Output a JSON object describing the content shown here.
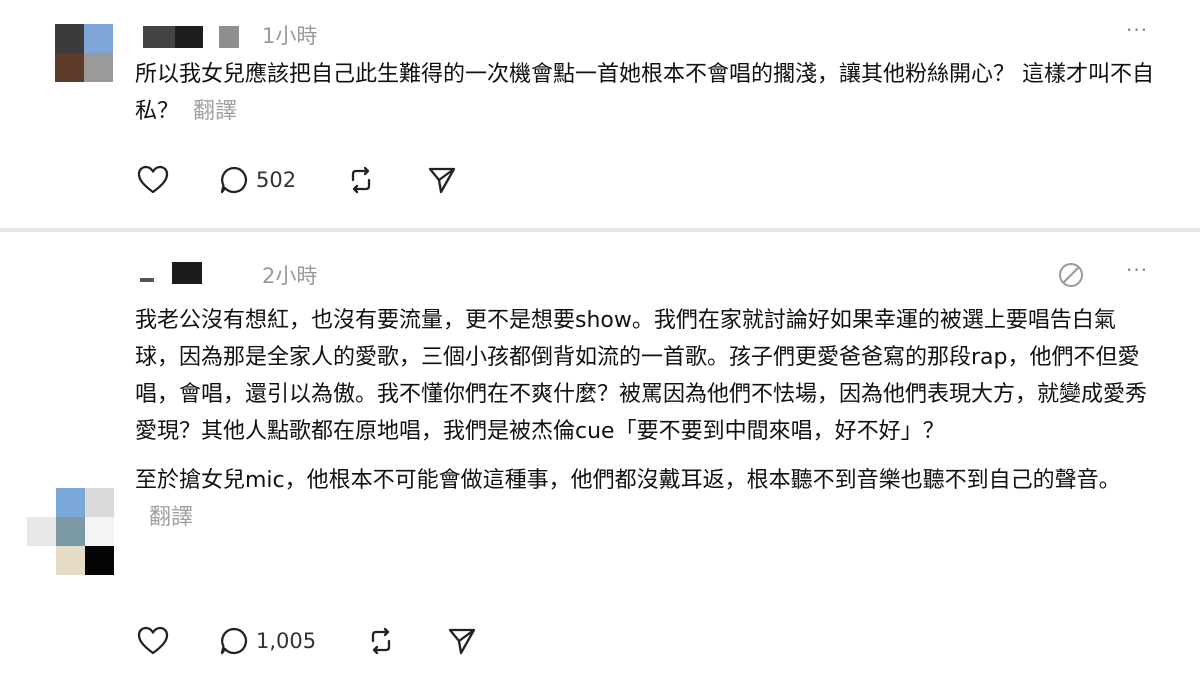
{
  "posts": [
    {
      "time": "1小時",
      "more": "···",
      "body": "所以我女兒應該把自己此生難得的一次機會點一首她根本不會唱的擱淺，讓其他粉絲開心？ 這樣才叫不自私？",
      "translate": "翻譯",
      "reply_count": "502"
    },
    {
      "time": "2小時",
      "more": "···",
      "paragraph1": "我老公沒有想紅，也沒有要流量，更不是想要show。我們在家就討論好如果幸運的被選上要唱告白氣球，因為那是全家人的愛歌，三個小孩都倒背如流的一首歌。孩子們更愛爸爸寫的那段rap，他們不但愛唱，會唱，還引以為傲。我不懂你們在不爽什麼？被罵因為他們不怯場，因為他們表現大方，就變成愛秀愛現？其他人點歌都在原地唱，我們是被杰倫cue「要不要到中間來唱，好不好」？",
      "paragraph2": "至於搶女兒mic，他根本不可能會做這種事，他們都沒戴耳返，根本聽不到音樂也聽不到自己的聲音。",
      "translate": "翻譯",
      "reply_count": "1,005"
    }
  ]
}
